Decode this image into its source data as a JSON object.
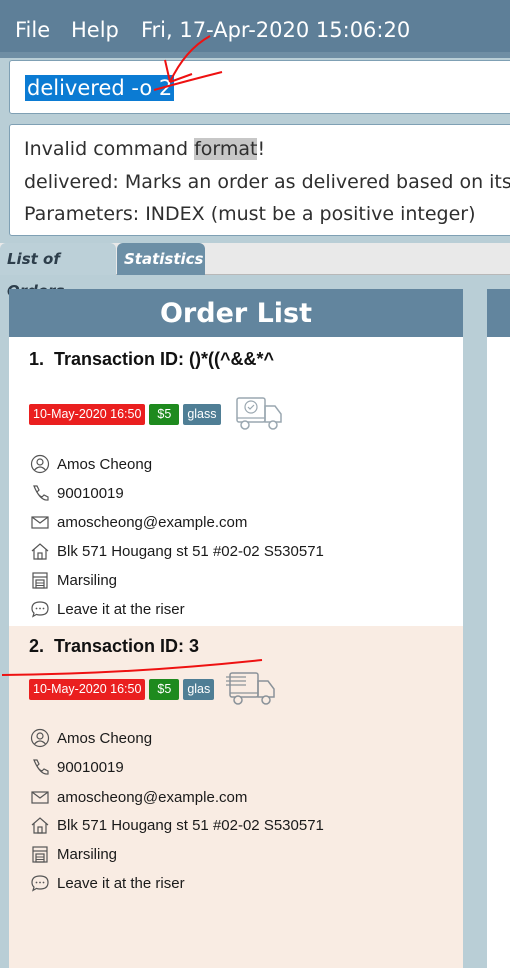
{
  "menu": {
    "file": "File",
    "help": "Help",
    "datetime": "Fri, 17-Apr-2020 15:06:20"
  },
  "command": {
    "value": "delivered -o 2"
  },
  "result": {
    "line1_pre": "Invalid command ",
    "line1_hl": "format",
    "line1_post": "!",
    "line2": "delivered: Marks an order as delivered based on its index",
    "line3": "Parameters: INDEX (must be a positive integer)"
  },
  "tabs": {
    "orders": "List of Orders",
    "statistics": "Statistics"
  },
  "panel": {
    "title": "Order List"
  },
  "orders": [
    {
      "index": "1.",
      "transaction": "Transaction ID: ()*((^&&*^",
      "date": "10-May-2020 16:50",
      "price": "$5",
      "item": "glass",
      "name": "Amos Cheong",
      "phone": "90010019",
      "email": "amoscheong@example.com",
      "address": "Blk 571 Hougang st 51 #02-02 S530571",
      "warehouse": "Marsiling",
      "comment": "Leave it at the riser",
      "status_icon": "delivered-truck-icon"
    },
    {
      "index": "2.",
      "transaction": "Transaction ID: 3",
      "date": "10-May-2020 16:50",
      "price": "$5",
      "item": "glas",
      "name": "Amos Cheong",
      "phone": "90010019",
      "email": "amoscheong@example.com",
      "address": "Blk 571 Hougang st 51 #02-02 S530571",
      "warehouse": "Marsiling",
      "comment": "Leave it at the riser",
      "status_icon": "pending-truck-icon"
    }
  ],
  "colors": {
    "menubar": "#5e7f98",
    "panel_header": "#62859e",
    "date_badge": "#ea1f1f",
    "price_badge": "#1e8a1e",
    "item_badge": "#4f7e95",
    "selection": "#0b7bd3"
  }
}
